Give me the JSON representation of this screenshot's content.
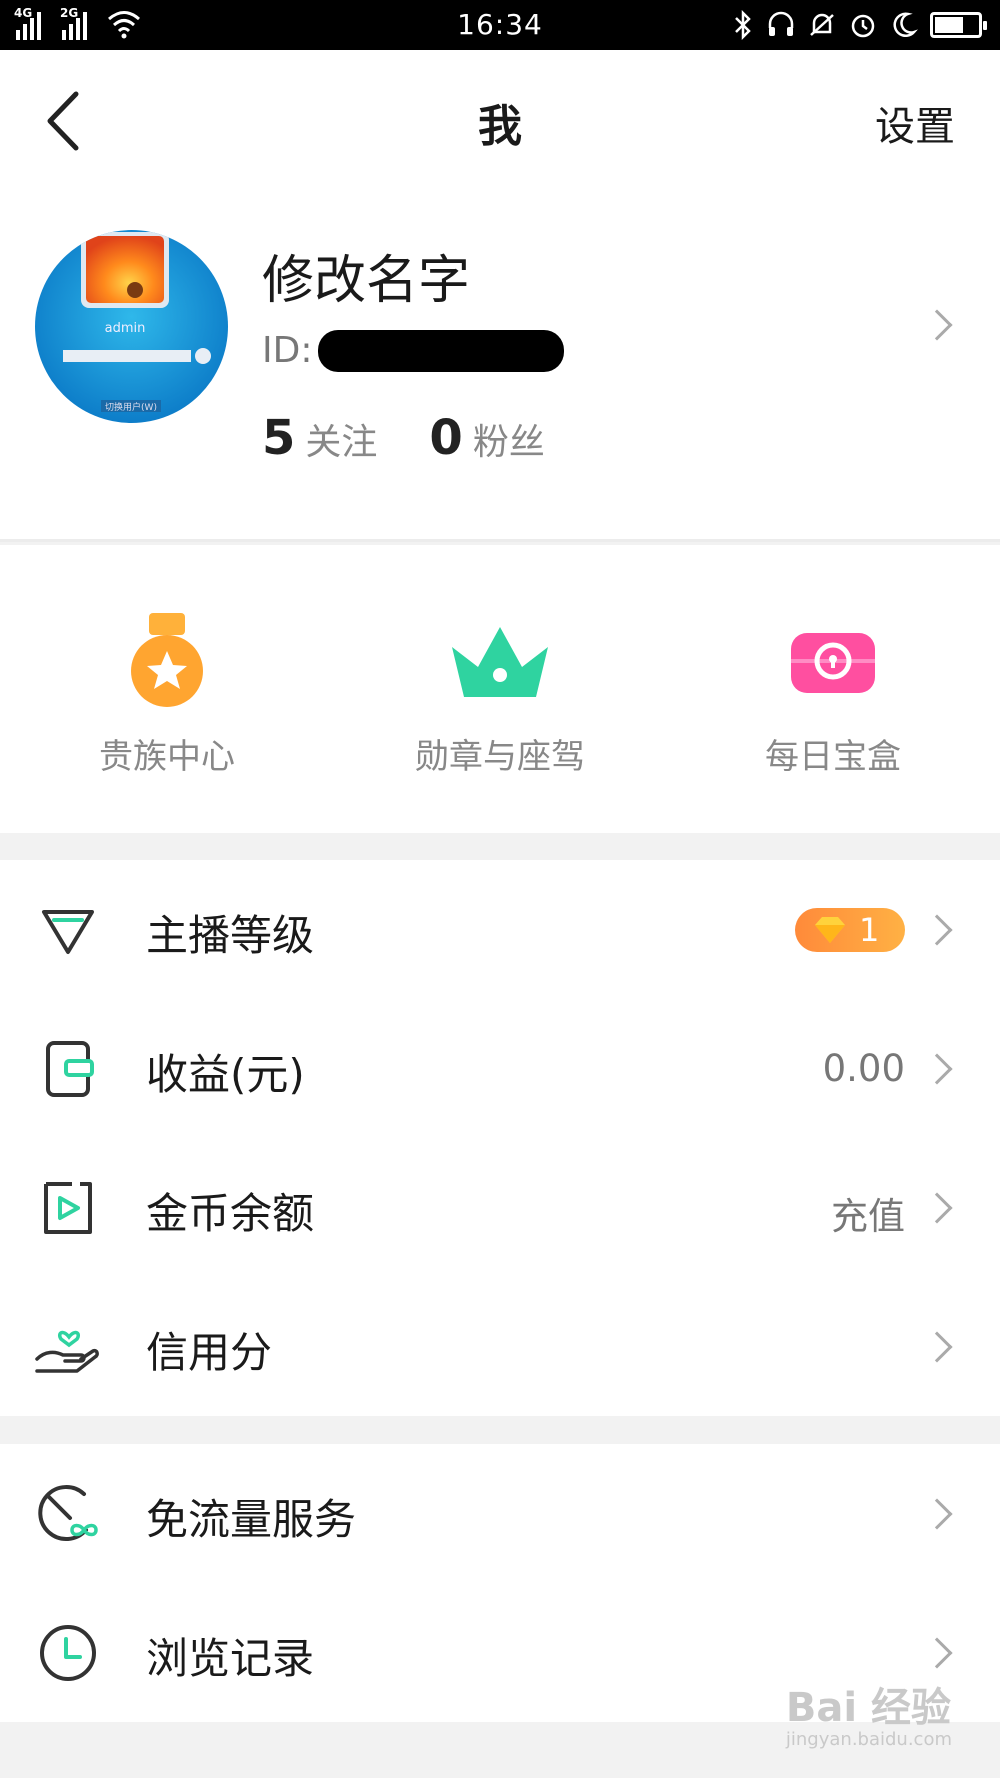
{
  "status_bar": {
    "time": "16:34",
    "net1": "4G",
    "net2": "2G"
  },
  "header": {
    "title": "我",
    "settings_label": "设置"
  },
  "profile": {
    "name": "修改名字",
    "id_label": "ID:",
    "following_count": "5",
    "following_label": "关注",
    "followers_count": "0",
    "followers_label": "粉丝",
    "avatar_text": "admin",
    "avatar_switch": "切换用户(W)"
  },
  "quick_actions": [
    {
      "label": "贵族中心",
      "icon": "medal-icon"
    },
    {
      "label": "勋章与座驾",
      "icon": "crown-icon"
    },
    {
      "label": "每日宝盒",
      "icon": "treasure-box-icon"
    }
  ],
  "menu_group_1": [
    {
      "label": "主播等级",
      "badge": "1",
      "icon": "diamond-icon"
    },
    {
      "label": "收益(元)",
      "value": "0.00",
      "icon": "wallet-icon"
    },
    {
      "label": "金币余额",
      "value": "充值",
      "icon": "coin-play-icon"
    },
    {
      "label": "信用分",
      "icon": "heart-hand-icon"
    }
  ],
  "menu_group_2": [
    {
      "label": "免流量服务",
      "icon": "free-data-icon"
    },
    {
      "label": "浏览记录",
      "icon": "clock-icon"
    }
  ],
  "watermark": {
    "brand": "Bai 经验",
    "url": "jingyan.baidu.com"
  },
  "colors": {
    "accent_green": "#2fd3a0",
    "orange": "#ffa53a",
    "pink": "#ff4fa0"
  }
}
